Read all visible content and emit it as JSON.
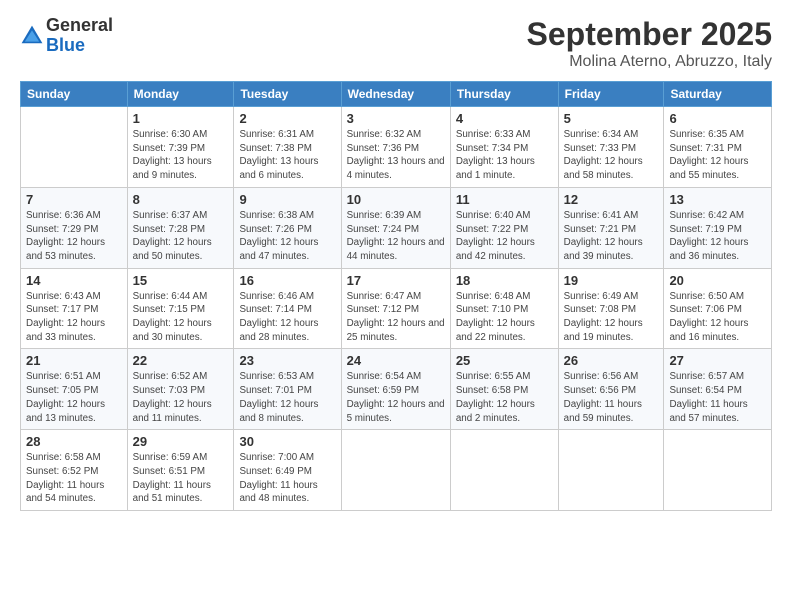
{
  "logo": {
    "general": "General",
    "blue": "Blue"
  },
  "header": {
    "month": "September 2025",
    "location": "Molina Aterno, Abruzzo, Italy"
  },
  "days_of_week": [
    "Sunday",
    "Monday",
    "Tuesday",
    "Wednesday",
    "Thursday",
    "Friday",
    "Saturday"
  ],
  "weeks": [
    [
      {
        "day": "",
        "sunrise": "",
        "sunset": "",
        "daylight": ""
      },
      {
        "day": "1",
        "sunrise": "Sunrise: 6:30 AM",
        "sunset": "Sunset: 7:39 PM",
        "daylight": "Daylight: 13 hours and 9 minutes."
      },
      {
        "day": "2",
        "sunrise": "Sunrise: 6:31 AM",
        "sunset": "Sunset: 7:38 PM",
        "daylight": "Daylight: 13 hours and 6 minutes."
      },
      {
        "day": "3",
        "sunrise": "Sunrise: 6:32 AM",
        "sunset": "Sunset: 7:36 PM",
        "daylight": "Daylight: 13 hours and 4 minutes."
      },
      {
        "day": "4",
        "sunrise": "Sunrise: 6:33 AM",
        "sunset": "Sunset: 7:34 PM",
        "daylight": "Daylight: 13 hours and 1 minute."
      },
      {
        "day": "5",
        "sunrise": "Sunrise: 6:34 AM",
        "sunset": "Sunset: 7:33 PM",
        "daylight": "Daylight: 12 hours and 58 minutes."
      },
      {
        "day": "6",
        "sunrise": "Sunrise: 6:35 AM",
        "sunset": "Sunset: 7:31 PM",
        "daylight": "Daylight: 12 hours and 55 minutes."
      }
    ],
    [
      {
        "day": "7",
        "sunrise": "Sunrise: 6:36 AM",
        "sunset": "Sunset: 7:29 PM",
        "daylight": "Daylight: 12 hours and 53 minutes."
      },
      {
        "day": "8",
        "sunrise": "Sunrise: 6:37 AM",
        "sunset": "Sunset: 7:28 PM",
        "daylight": "Daylight: 12 hours and 50 minutes."
      },
      {
        "day": "9",
        "sunrise": "Sunrise: 6:38 AM",
        "sunset": "Sunset: 7:26 PM",
        "daylight": "Daylight: 12 hours and 47 minutes."
      },
      {
        "day": "10",
        "sunrise": "Sunrise: 6:39 AM",
        "sunset": "Sunset: 7:24 PM",
        "daylight": "Daylight: 12 hours and 44 minutes."
      },
      {
        "day": "11",
        "sunrise": "Sunrise: 6:40 AM",
        "sunset": "Sunset: 7:22 PM",
        "daylight": "Daylight: 12 hours and 42 minutes."
      },
      {
        "day": "12",
        "sunrise": "Sunrise: 6:41 AM",
        "sunset": "Sunset: 7:21 PM",
        "daylight": "Daylight: 12 hours and 39 minutes."
      },
      {
        "day": "13",
        "sunrise": "Sunrise: 6:42 AM",
        "sunset": "Sunset: 7:19 PM",
        "daylight": "Daylight: 12 hours and 36 minutes."
      }
    ],
    [
      {
        "day": "14",
        "sunrise": "Sunrise: 6:43 AM",
        "sunset": "Sunset: 7:17 PM",
        "daylight": "Daylight: 12 hours and 33 minutes."
      },
      {
        "day": "15",
        "sunrise": "Sunrise: 6:44 AM",
        "sunset": "Sunset: 7:15 PM",
        "daylight": "Daylight: 12 hours and 30 minutes."
      },
      {
        "day": "16",
        "sunrise": "Sunrise: 6:46 AM",
        "sunset": "Sunset: 7:14 PM",
        "daylight": "Daylight: 12 hours and 28 minutes."
      },
      {
        "day": "17",
        "sunrise": "Sunrise: 6:47 AM",
        "sunset": "Sunset: 7:12 PM",
        "daylight": "Daylight: 12 hours and 25 minutes."
      },
      {
        "day": "18",
        "sunrise": "Sunrise: 6:48 AM",
        "sunset": "Sunset: 7:10 PM",
        "daylight": "Daylight: 12 hours and 22 minutes."
      },
      {
        "day": "19",
        "sunrise": "Sunrise: 6:49 AM",
        "sunset": "Sunset: 7:08 PM",
        "daylight": "Daylight: 12 hours and 19 minutes."
      },
      {
        "day": "20",
        "sunrise": "Sunrise: 6:50 AM",
        "sunset": "Sunset: 7:06 PM",
        "daylight": "Daylight: 12 hours and 16 minutes."
      }
    ],
    [
      {
        "day": "21",
        "sunrise": "Sunrise: 6:51 AM",
        "sunset": "Sunset: 7:05 PM",
        "daylight": "Daylight: 12 hours and 13 minutes."
      },
      {
        "day": "22",
        "sunrise": "Sunrise: 6:52 AM",
        "sunset": "Sunset: 7:03 PM",
        "daylight": "Daylight: 12 hours and 11 minutes."
      },
      {
        "day": "23",
        "sunrise": "Sunrise: 6:53 AM",
        "sunset": "Sunset: 7:01 PM",
        "daylight": "Daylight: 12 hours and 8 minutes."
      },
      {
        "day": "24",
        "sunrise": "Sunrise: 6:54 AM",
        "sunset": "Sunset: 6:59 PM",
        "daylight": "Daylight: 12 hours and 5 minutes."
      },
      {
        "day": "25",
        "sunrise": "Sunrise: 6:55 AM",
        "sunset": "Sunset: 6:58 PM",
        "daylight": "Daylight: 12 hours and 2 minutes."
      },
      {
        "day": "26",
        "sunrise": "Sunrise: 6:56 AM",
        "sunset": "Sunset: 6:56 PM",
        "daylight": "Daylight: 11 hours and 59 minutes."
      },
      {
        "day": "27",
        "sunrise": "Sunrise: 6:57 AM",
        "sunset": "Sunset: 6:54 PM",
        "daylight": "Daylight: 11 hours and 57 minutes."
      }
    ],
    [
      {
        "day": "28",
        "sunrise": "Sunrise: 6:58 AM",
        "sunset": "Sunset: 6:52 PM",
        "daylight": "Daylight: 11 hours and 54 minutes."
      },
      {
        "day": "29",
        "sunrise": "Sunrise: 6:59 AM",
        "sunset": "Sunset: 6:51 PM",
        "daylight": "Daylight: 11 hours and 51 minutes."
      },
      {
        "day": "30",
        "sunrise": "Sunrise: 7:00 AM",
        "sunset": "Sunset: 6:49 PM",
        "daylight": "Daylight: 11 hours and 48 minutes."
      },
      {
        "day": "",
        "sunrise": "",
        "sunset": "",
        "daylight": ""
      },
      {
        "day": "",
        "sunrise": "",
        "sunset": "",
        "daylight": ""
      },
      {
        "day": "",
        "sunrise": "",
        "sunset": "",
        "daylight": ""
      },
      {
        "day": "",
        "sunrise": "",
        "sunset": "",
        "daylight": ""
      }
    ]
  ]
}
